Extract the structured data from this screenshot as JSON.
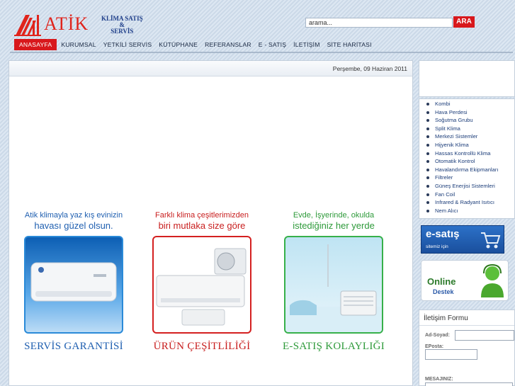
{
  "header": {
    "logo_name": "ATİK",
    "logo_sub_line1": "KLİMA SATIŞ",
    "logo_sub_line2": "&",
    "logo_sub_line3": "SERVİS",
    "search_placeholder": "arama...",
    "search_button": "ARA"
  },
  "nav": {
    "items": [
      "ANASAYFA",
      "KURUMSAL",
      "YETKİLİ SERVİS",
      "KÜTÜPHANE",
      "REFERANSLAR",
      "E - SATIŞ",
      "İLETİŞİM",
      "SİTE HARİTASI"
    ],
    "active_index": 0
  },
  "main": {
    "date": "Perşembe, 09 Haziran 2011",
    "promos": [
      {
        "line1": "Atik klimayla yaz kış evinizin",
        "line2": "havası güzel olsun.",
        "footer": "SERVİS GARANTİSİ",
        "color": "#1f5fb0",
        "border": "#2a8ad8"
      },
      {
        "line1": "Farklı klima çeşitlerimizden",
        "line2": "biri mutlaka size göre",
        "footer": "ÜRÜN ÇEŞİTLİLİĞİ",
        "color": "#c81e1e",
        "border": "#d42020"
      },
      {
        "line1": "Evde, İşyerinde, okulda",
        "line2": "istediğiniz her yerde",
        "footer": "E-SATIŞ KOLAYLIĞI",
        "color": "#2e9a3a",
        "border": "#37b04a"
      }
    ]
  },
  "sidebar": {
    "categories": [
      "Kombi",
      "Hava Perdesi",
      "Soğutma Grubu",
      "Split Klima",
      "Merkezi Sistemler",
      "Hijyenik Klima",
      "Hassas Kontrollü Klima",
      "Otomatik Kontrol",
      "Havalandırma Ekipmanları",
      "Filtreler",
      "Güneş Enerjisi Sistemleri",
      "Fan Coil",
      "Infrared & Radyant Isıtıcı",
      "Nem Alıcı"
    ],
    "esatis_title": "e-satış",
    "esatis_sub": "sitemiz için",
    "online_title": "Online",
    "online_sub": "Destek",
    "contact_title": "İletişim Formu",
    "contact_labels": {
      "name": "Ad-Soyad:",
      "email": "EPosta:",
      "message": "MESAJINIZ:"
    }
  }
}
